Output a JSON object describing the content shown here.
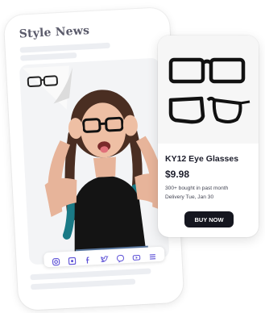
{
  "article": {
    "site_title": "Style News",
    "social_icons": [
      "instagram-icon",
      "square-icon",
      "facebook-icon",
      "twitter-icon",
      "messenger-icon",
      "youtube-icon",
      "menu-icon"
    ]
  },
  "product": {
    "name": "KY12 Eye Glasses",
    "price": "$9.98",
    "bought": "300+ bought in past month",
    "delivery": "Delivery Tue, Jan 30",
    "buy_label": "BUY NOW"
  },
  "colors": {
    "accent": "#5b4fd6",
    "button": "#15161f",
    "text": "#1c1d2b"
  }
}
